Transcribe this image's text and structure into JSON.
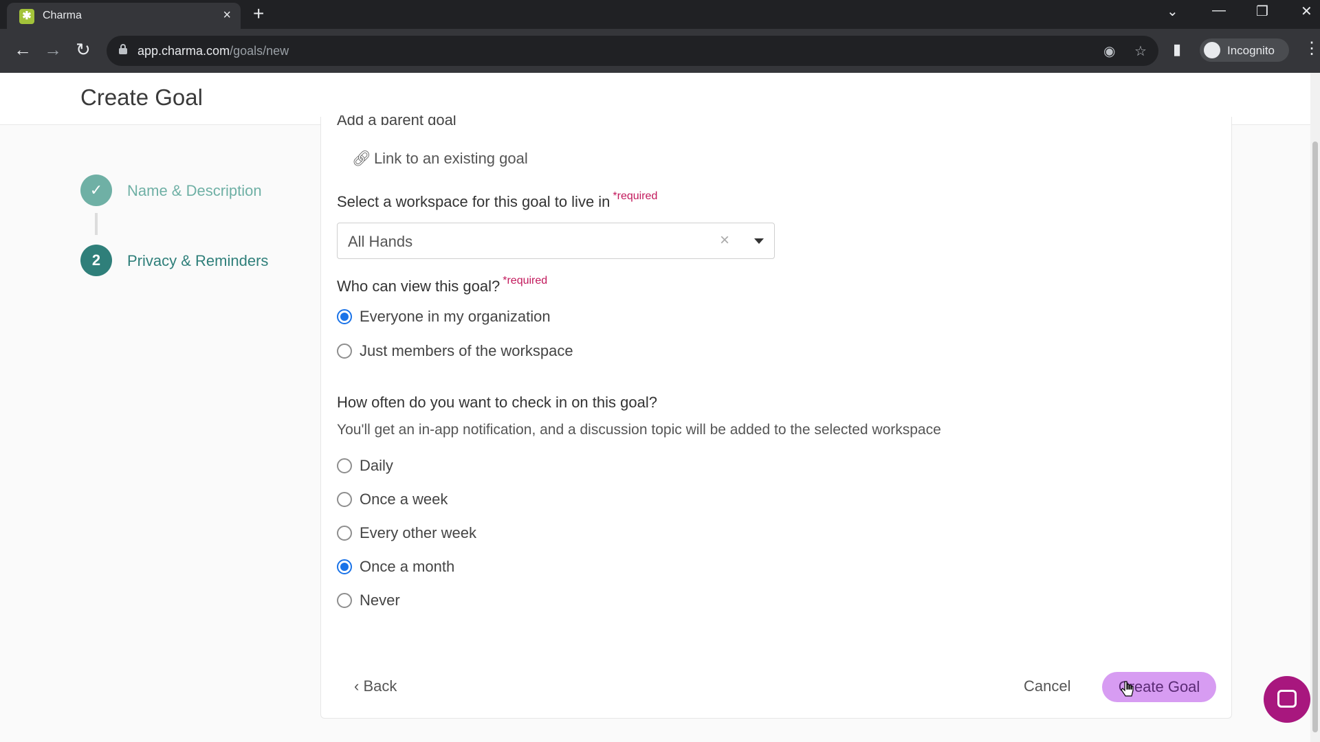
{
  "browser": {
    "tab_title": "Charma",
    "favicon": "✱",
    "new_tab": "+",
    "url_domain": "app.charma.com",
    "url_path": "/goals/new",
    "profile_label": "Incognito"
  },
  "header": {
    "title": "Create Goal"
  },
  "stepper": {
    "steps": [
      {
        "number": "✓",
        "label": "Name & Description",
        "state": "completed"
      },
      {
        "number": "2",
        "label": "Privacy & Reminders",
        "state": "active"
      }
    ]
  },
  "form": {
    "parent_goal_label": "Add a parent goal",
    "link_existing": "Link to an existing goal",
    "workspace_label": "Select a workspace for this goal to live in",
    "required_marker": "*required",
    "workspace_value": "All Hands",
    "visibility_label": "Who can view this goal?",
    "visibility_options": [
      {
        "label": "Everyone in my organization",
        "checked": true
      },
      {
        "label": "Just members of the workspace",
        "checked": false
      }
    ],
    "checkin_label": "How often do you want to check in on this goal?",
    "checkin_helper": "You'll get an in-app notification, and a discussion topic will be added to the selected workspace",
    "checkin_options": [
      {
        "label": "Daily",
        "checked": false
      },
      {
        "label": "Once a week",
        "checked": false
      },
      {
        "label": "Every other week",
        "checked": false
      },
      {
        "label": "Once a month",
        "checked": true
      },
      {
        "label": "Never",
        "checked": false
      }
    ]
  },
  "footer": {
    "back_label": "Back",
    "cancel_label": "Cancel",
    "create_label": "Create Goal"
  },
  "colors": {
    "accent_teal": "#2f7f7a",
    "completed_teal": "#6fb0a5",
    "radio_blue": "#1a73e8",
    "create_button": "#d79cf2",
    "required_pink": "#c2185b",
    "chat_bubble": "#a8177e"
  }
}
